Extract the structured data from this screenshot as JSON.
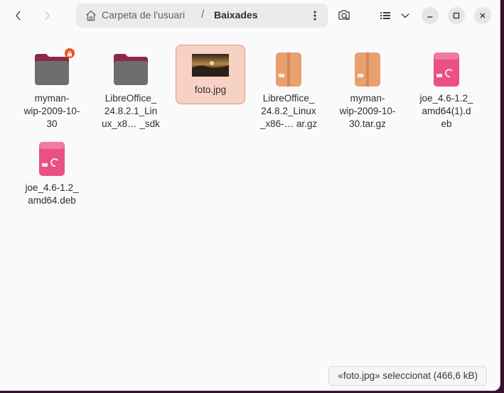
{
  "breadcrumb": {
    "home_label": "Carpeta de l'usuari",
    "separator": "/",
    "current": "Baixades"
  },
  "icons": {
    "back": "chevron-left-icon",
    "forward": "chevron-right-icon",
    "home": "home-icon",
    "path_menu": "vertical-dots-icon",
    "search": "search-icon",
    "view": "list-view-icon",
    "view_options": "chevron-down-icon",
    "minimize": "minimize-icon",
    "maximize": "maximize-icon",
    "close": "close-icon"
  },
  "files": [
    {
      "label": "myman-\nwip-2009-10-\n30",
      "kind": "folder",
      "locked": true
    },
    {
      "label": "LibreOffice_\n24.8.2.1_Lin\nux_x8… _sdk",
      "kind": "folder",
      "locked": false
    },
    {
      "label": "foto.jpg",
      "kind": "image",
      "selected": true
    },
    {
      "label": "LibreOffice_\n24.8.2_Linux\n_x86-… ar.gz",
      "kind": "archive"
    },
    {
      "label": "myman-\nwip-2009-10-\n30.tar.gz",
      "kind": "archive"
    },
    {
      "label": "joe_4.6-1.2_\namd64(1).d\neb",
      "kind": "deb"
    },
    {
      "label": "joe_4.6-1.2_\namd64.deb",
      "kind": "deb"
    }
  ],
  "status": {
    "text": "«foto.jpg» seleccionat  (466,6 kB)"
  },
  "colors": {
    "accent": "#e95420",
    "selection": "#f7d2c4",
    "folder_top": "#8c2a45",
    "folder_body": "#6e6e6e",
    "archive": "#e8a070",
    "deb": "#ea4f86"
  }
}
